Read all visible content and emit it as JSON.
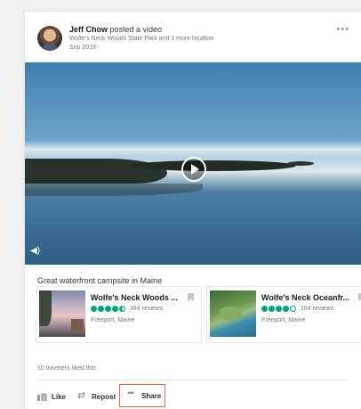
{
  "post": {
    "author": "Jeff Chow",
    "action": " posted a video",
    "location": "Wolfe's Neck Woods State Park and 1 more location",
    "date": "Sep 2018",
    "more_label": "•••"
  },
  "video": {
    "play_icon": "play-icon",
    "mute_icon": "speaker-icon"
  },
  "caption": "Great waterfront campsite in Maine",
  "places": [
    {
      "name": "Wolfe's Neck Woods ...",
      "rating": 4.5,
      "reviews": "384 reviews",
      "location": "Freeport, Maine"
    },
    {
      "name": "Wolfe's Neck Oceanfr...",
      "rating": 4.0,
      "reviews": "164 reviews",
      "location": "Freeport, Maine"
    }
  ],
  "likes_text": "10 travelers liked this",
  "actions": {
    "like": "Like",
    "repost": "Repost",
    "share": "Share"
  },
  "colors": {
    "rating": "#00a680",
    "share_highlight": "#e8642c"
  }
}
